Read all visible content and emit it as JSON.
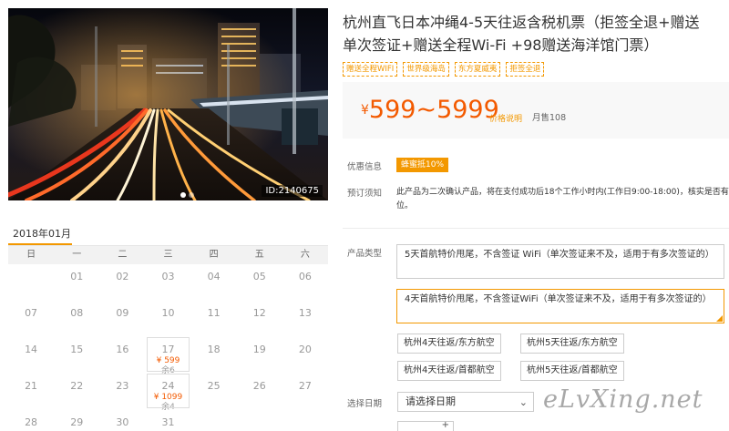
{
  "product": {
    "title_line1": "杭州直飞日本冲绳4-5天往返含税机票（拒签全退+赠送",
    "title_line2": "单次签证+赠送全程Wi-Fi +98赠送海洋馆门票）",
    "tags": [
      "赠送全程WIFI",
      "世界级海岛",
      "东方夏威夷",
      "拒签全退"
    ],
    "image_id": "ID:2140675"
  },
  "price": {
    "currency": "¥",
    "range": "599~5999",
    "note": "价格说明",
    "sold": "月售108"
  },
  "info": {
    "promo_label": "优惠信息",
    "promo_badge": "蜂蜜抵10%",
    "notice_label": "预订须知",
    "notice_text": "此产品为二次确认产品，将在支付成功后18个工作小时内(工作日9:00-18:00)，核实是否有位。",
    "type_label": "产品类型",
    "date_label": "选择日期"
  },
  "packages": [
    {
      "text": "5天首航特价甩尾，不含签证 WiFi（单次签证来不及，适用于有多次签证的）"
    },
    {
      "text": "4天首航特价甩尾，不含签证WiFi（单次签证来不及，适用于有多次签证的）"
    }
  ],
  "routes": [
    "杭州4天往返/东方航空",
    "杭州5天往返/东方航空",
    "杭州4天往返/首都航空",
    "杭州5天往返/首都航空"
  ],
  "date_select": {
    "value": "请选择日期"
  },
  "qty_plus": "+",
  "calendar": {
    "month": "2018年01月",
    "weekdays": [
      "日",
      "一",
      "二",
      "三",
      "四",
      "五",
      "六"
    ],
    "days": [
      {
        "d": "",
        "p": "",
        "r": ""
      },
      {
        "d": "01",
        "p": "",
        "r": ""
      },
      {
        "d": "02",
        "p": "",
        "r": ""
      },
      {
        "d": "03",
        "p": "",
        "r": ""
      },
      {
        "d": "04",
        "p": "",
        "r": ""
      },
      {
        "d": "05",
        "p": "",
        "r": ""
      },
      {
        "d": "06",
        "p": "",
        "r": ""
      },
      {
        "d": "07",
        "p": "",
        "r": ""
      },
      {
        "d": "08",
        "p": "",
        "r": ""
      },
      {
        "d": "09",
        "p": "",
        "r": ""
      },
      {
        "d": "10",
        "p": "",
        "r": ""
      },
      {
        "d": "11",
        "p": "",
        "r": ""
      },
      {
        "d": "12",
        "p": "",
        "r": ""
      },
      {
        "d": "13",
        "p": "",
        "r": ""
      },
      {
        "d": "14",
        "p": "",
        "r": ""
      },
      {
        "d": "15",
        "p": "",
        "r": ""
      },
      {
        "d": "16",
        "p": "",
        "r": ""
      },
      {
        "d": "17",
        "p": "¥ 599",
        "r": "余6"
      },
      {
        "d": "18",
        "p": "",
        "r": ""
      },
      {
        "d": "19",
        "p": "",
        "r": ""
      },
      {
        "d": "20",
        "p": "",
        "r": ""
      },
      {
        "d": "21",
        "p": "",
        "r": ""
      },
      {
        "d": "22",
        "p": "",
        "r": ""
      },
      {
        "d": "23",
        "p": "",
        "r": ""
      },
      {
        "d": "24",
        "p": "¥ 1099",
        "r": "余4"
      },
      {
        "d": "25",
        "p": "",
        "r": ""
      },
      {
        "d": "26",
        "p": "",
        "r": ""
      },
      {
        "d": "27",
        "p": "",
        "r": ""
      },
      {
        "d": "28",
        "p": "",
        "r": ""
      },
      {
        "d": "29",
        "p": "",
        "r": ""
      },
      {
        "d": "30",
        "p": "",
        "r": ""
      },
      {
        "d": "31",
        "p": "",
        "r": ""
      }
    ]
  },
  "watermark": "eLvXing.net"
}
